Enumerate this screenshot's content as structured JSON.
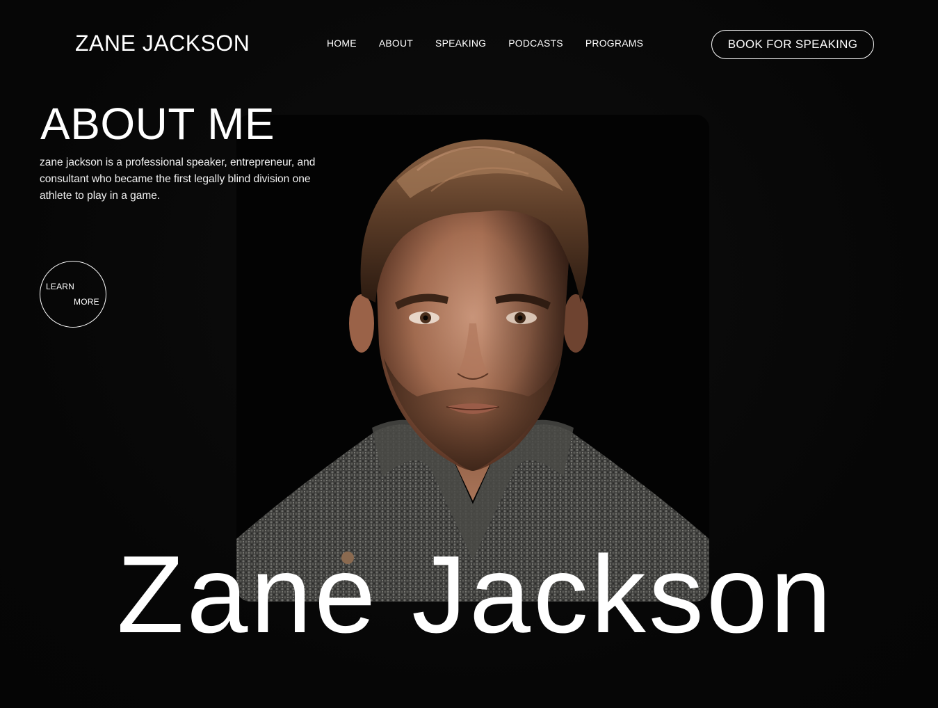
{
  "header": {
    "logo": "ZANE JACKSON",
    "nav": [
      "HOME",
      "ABOUT",
      "SPEAKING",
      "PODCASTS",
      "PROGRAMS"
    ],
    "cta_label": "BOOK FOR SPEAKING"
  },
  "hero": {
    "title": "ABOUT ME",
    "description": "zane jackson is a professional speaker, entrepreneur, and consultant who became the first legally blind division one athlete to play in a game.",
    "learn_more_line1": "LEARN",
    "learn_more_line2": "MORE",
    "big_name": "Zane Jackson"
  },
  "colors": {
    "background": "#070707",
    "text": "#ffffff",
    "accent": "#ffffff"
  }
}
